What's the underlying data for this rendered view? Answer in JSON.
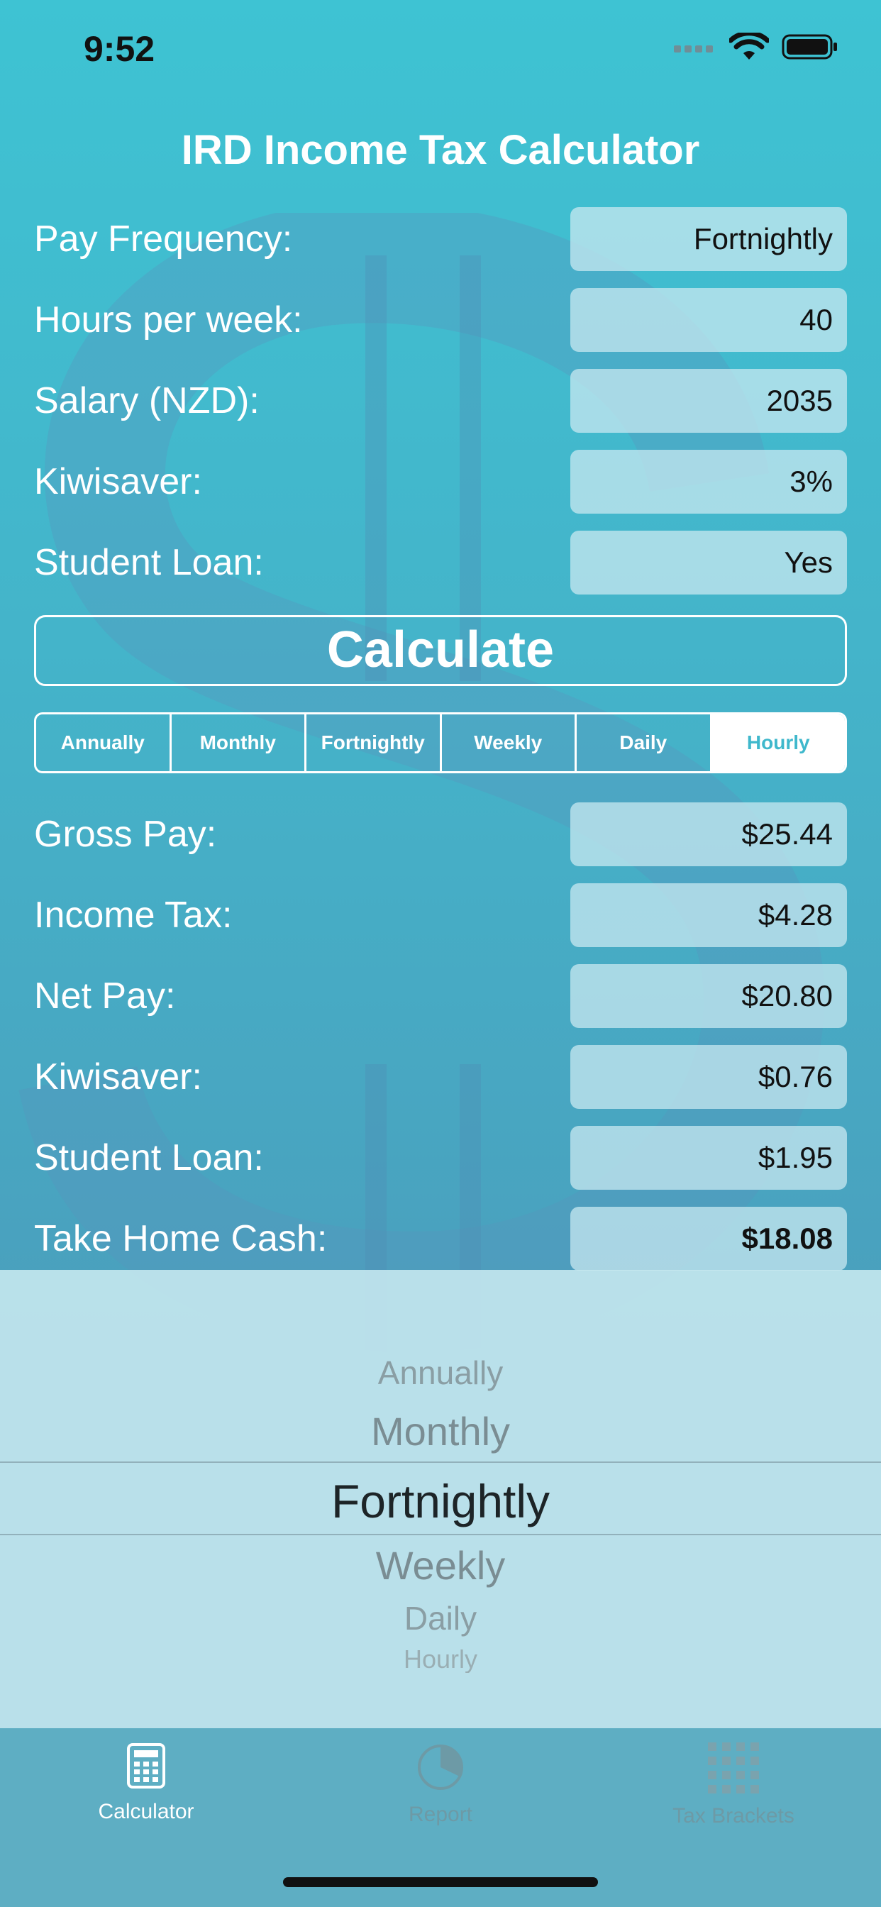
{
  "status_bar": {
    "time": "9:52"
  },
  "title": "IRD Income Tax Calculator",
  "inputs": [
    {
      "label": "Pay Frequency:",
      "value": "Fortnightly"
    },
    {
      "label": "Hours per week:",
      "value": "40"
    },
    {
      "label": "Salary (NZD):",
      "value": "2035"
    },
    {
      "label": "Kiwisaver:",
      "value": "3%"
    },
    {
      "label": "Student Loan:",
      "value": "Yes"
    }
  ],
  "calculate_label": "Calculate",
  "period_tabs": {
    "options": [
      "Annually",
      "Monthly",
      "Fortnightly",
      "Weekly",
      "Daily",
      "Hourly"
    ],
    "selected": "Hourly"
  },
  "results": [
    {
      "label": "Gross Pay:",
      "value": "$25.44"
    },
    {
      "label": "Income Tax:",
      "value": "$4.28"
    },
    {
      "label": "Net Pay:",
      "value": "$20.80"
    },
    {
      "label": "Kiwisaver:",
      "value": "$0.76"
    },
    {
      "label": "Student Loan:",
      "value": "$1.95"
    },
    {
      "label": "Take Home Cash:",
      "value": "$18.08"
    }
  ],
  "picker": {
    "options": [
      "Annually",
      "Monthly",
      "Fortnightly",
      "Weekly",
      "Daily",
      "Hourly"
    ],
    "selected": "Fortnightly"
  },
  "tabbar": {
    "items": [
      {
        "label": "Calculator",
        "icon": "calculator-icon",
        "active": true
      },
      {
        "label": "Report",
        "icon": "pie-chart-icon",
        "active": false
      },
      {
        "label": "Tax Brackets",
        "icon": "grid-icon",
        "active": false
      }
    ]
  },
  "colors": {
    "background_top": "#3ec3d3",
    "background_bottom": "#4a9cba",
    "segment_active_text": "#3fb8cc",
    "tabbar": "#5eaec3"
  }
}
